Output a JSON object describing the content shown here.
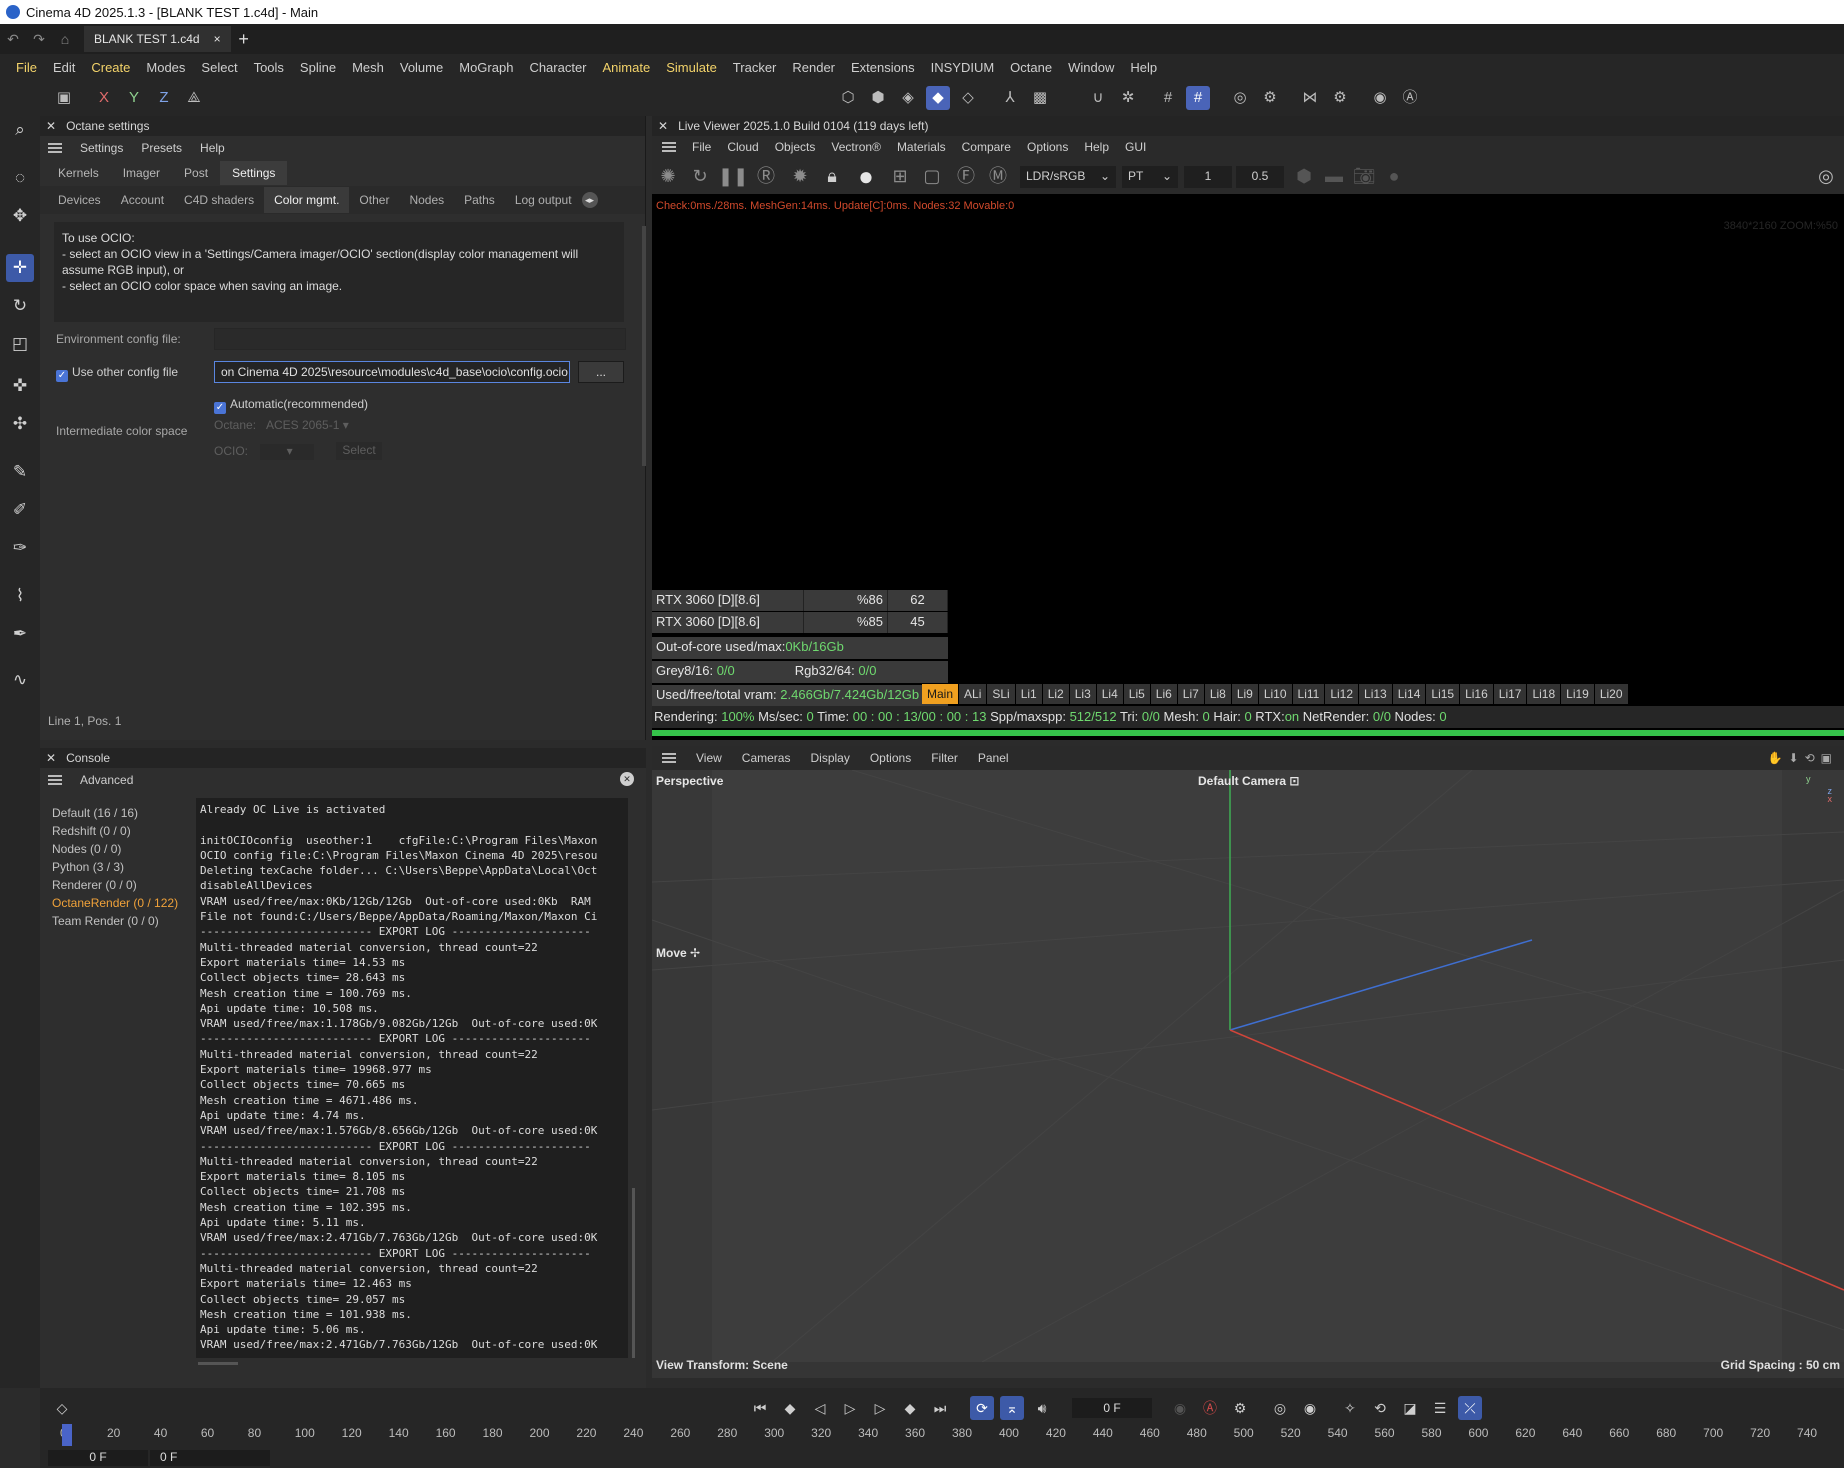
{
  "window": {
    "title": "Cinema 4D 2025.1.3 - [BLANK TEST 1.c4d] - Main"
  },
  "doc_tab": {
    "name": "BLANK TEST 1.c4d",
    "close": "×",
    "add": "+"
  },
  "menubar": [
    "File",
    "Edit",
    "Create",
    "Modes",
    "Select",
    "Tools",
    "Spline",
    "Mesh",
    "Volume",
    "MoGraph",
    "Character",
    "Animate",
    "Simulate",
    "Tracker",
    "Render",
    "Extensions",
    "INSYDIUM",
    "Octane",
    "Window",
    "Help"
  ],
  "axis_buttons": [
    "X",
    "Y",
    "Z"
  ],
  "octane_settings": {
    "title": "Octane settings",
    "menu": [
      "Settings",
      "Presets",
      "Help"
    ],
    "tabs": [
      "Kernels",
      "Imager",
      "Post",
      "Settings"
    ],
    "active_tab": "Settings",
    "subtabs": [
      "Devices",
      "Account",
      "C4D shaders",
      "Color mgmt.",
      "Other",
      "Nodes",
      "Paths",
      "Log output"
    ],
    "active_subtab": "Color mgmt.",
    "info_lines": [
      "To use OCIO:",
      "- select an OCIO view in a 'Settings/Camera imager/OCIO' section(display color management will",
      "assume RGB input), or",
      "- select an OCIO color space when saving an image."
    ],
    "env_config_label": "Environment config file:",
    "use_other_label": "Use other config file",
    "config_path": "on Cinema 4D 2025\\resource\\modules\\c4d_base\\ocio\\config.ocio",
    "browse_label": "...",
    "automatic_label": "Automatic(recommended)",
    "intermediate_label": "Intermediate color space",
    "octane_label": "Octane:",
    "octane_value": "ACES 2065-1",
    "ocio_label": "OCIO:",
    "select_label": "Select",
    "status": "Line 1, Pos. 1"
  },
  "console": {
    "title": "Console",
    "mode": "Advanced",
    "categories": [
      "Default (16 / 16)",
      "Redshift (0 / 0)",
      "Nodes (0 / 0)",
      "Python (3 / 3)",
      "Renderer (0 / 0)",
      "OctaneRender (0 / 122)",
      "Team Render  (0 / 0)"
    ],
    "selected_category": "OctaneRender (0 / 122)",
    "log": [
      "Already OC Live is activated",
      "",
      "initOCIOconfig  useother:1    cfgFile:C:\\Program Files\\Maxon",
      "OCIO config file:C:\\Program Files\\Maxon Cinema 4D 2025\\resou",
      "Deleting texCache folder... C:\\Users\\Beppe\\AppData\\Local\\Oct",
      "disableAllDevices",
      "VRAM used/free/max:0Kb/12Gb/12Gb  Out-of-core used:0Kb  RAM",
      "File not found:C:/Users/Beppe/AppData/Roaming/Maxon/Maxon Ci",
      "-------------------------- EXPORT LOG ---------------------",
      "Multi-threaded material conversion, thread count=22",
      "Export materials time= 14.53 ms",
      "Collect objects time= 28.643 ms",
      "Mesh creation time = 100.769 ms.",
      "Api update time: 10.508 ms.",
      "VRAM used/free/max:1.178Gb/9.082Gb/12Gb  Out-of-core used:0K",
      "-------------------------- EXPORT LOG ---------------------",
      "Multi-threaded material conversion, thread count=22",
      "Export materials time= 19968.977 ms",
      "Collect objects time= 70.665 ms",
      "Mesh creation time = 4671.486 ms.",
      "Api update time: 4.74 ms.",
      "VRAM used/free/max:1.576Gb/8.656Gb/12Gb  Out-of-core used:0K",
      "-------------------------- EXPORT LOG ---------------------",
      "Multi-threaded material conversion, thread count=22",
      "Export materials time= 8.105 ms",
      "Collect objects time= 21.708 ms",
      "Mesh creation time = 102.395 ms.",
      "Api update time: 5.11 ms.",
      "VRAM used/free/max:2.471Gb/7.763Gb/12Gb  Out-of-core used:0K",
      "-------------------------- EXPORT LOG ---------------------",
      "Multi-threaded material conversion, thread count=22",
      "Export materials time= 12.463 ms",
      "Collect objects time= 29.057 ms",
      "Mesh creation time = 101.938 ms.",
      "Api update time: 5.06 ms.",
      "VRAM used/free/max:2.471Gb/7.763Gb/12Gb  Out-of-core used:0K"
    ]
  },
  "live_viewer": {
    "title": "Live Viewer 2025.1.0 Build 0104 (119 days left)",
    "menu": [
      "File",
      "Cloud",
      "Objects",
      "Vectron®",
      "Materials",
      "Compare",
      "Options",
      "Help",
      "GUI"
    ],
    "color_space": "LDR/sRGB",
    "kernel": "PT",
    "field1": "1",
    "field2": "0.5",
    "status_line": "Check:0ms./28ms. MeshGen:14ms. Update[C]:0ms. Nodes:32 Movable:0",
    "resolution": "3840*2160 ZOOM:%50",
    "gpus": [
      {
        "name": "RTX 3060 [D][8.6]",
        "load": "%86",
        "temp": "62"
      },
      {
        "name": "RTX 3060 [D][8.6]",
        "load": "%85",
        "temp": "45"
      }
    ],
    "out_of_core_label": "Out-of-core used/max:",
    "out_of_core_value": "0Kb/16Gb",
    "grey_label": "Grey8/16: ",
    "grey_value": "0/0",
    "rgb_label": "Rgb32/64: ",
    "rgb_value": "0/0",
    "vram_label": "Used/free/total vram: ",
    "vram_value": "2.466Gb/7.424Gb/12Gb",
    "light_tabs": [
      "Main",
      "ALi",
      "SLi",
      "Li1",
      "Li2",
      "Li3",
      "Li4",
      "Li5",
      "Li6",
      "Li7",
      "Li8",
      "Li9",
      "Li10",
      "Li11",
      "Li12",
      "Li13",
      "Li14",
      "Li15",
      "Li16",
      "Li17",
      "Li18",
      "Li19",
      "Li20"
    ],
    "active_light_tab": "Main",
    "render_stats": {
      "rendering_label": "Rendering: ",
      "rendering_value": "100%",
      "mssec_label": " Ms/sec: ",
      "mssec_value": "0",
      "time_label": "  Time: ",
      "time_value": "00 : 00 : 13/00 : 00 : 13",
      "spp_label": "  Spp/maxspp: ",
      "spp_value": "512/512",
      "tri_label": "  Tri: ",
      "tri_value": "0/0",
      "mesh_label": "  Mesh: ",
      "mesh_value": "0",
      "hair_label": "  Hair: ",
      "hair_value": "0",
      "rtx_label": "  RTX:",
      "rtx_value": "on",
      "netrender_label": "  NetRender: ",
      "netrender_value": "0/0",
      "nodes_label": "  Nodes: ",
      "nodes_value": "0"
    },
    "progress": 1.0
  },
  "viewport": {
    "menu": [
      "View",
      "Cameras",
      "Display",
      "Options",
      "Filter",
      "Panel"
    ],
    "projection": "Perspective",
    "camera": "Default Camera",
    "tool_label": "Move",
    "view_transform": "View Transform: Scene",
    "grid_spacing": "Grid Spacing : 50 cm",
    "axis_colors": {
      "x": "#d0453a",
      "y": "#3fae54",
      "z": "#3f6fd1"
    }
  },
  "timeline": {
    "current_frame": "0 F",
    "start_field": "0 F",
    "end_field": "0 F",
    "ticks": [
      "0",
      "20",
      "40",
      "60",
      "80",
      "100",
      "120",
      "140",
      "160",
      "180",
      "200",
      "220",
      "240",
      "260",
      "280",
      "300",
      "320",
      "340",
      "360",
      "380",
      "400",
      "420",
      "440",
      "460",
      "480",
      "500",
      "520",
      "540",
      "560",
      "580",
      "600",
      "620",
      "640",
      "660",
      "680",
      "700",
      "720",
      "740"
    ]
  }
}
